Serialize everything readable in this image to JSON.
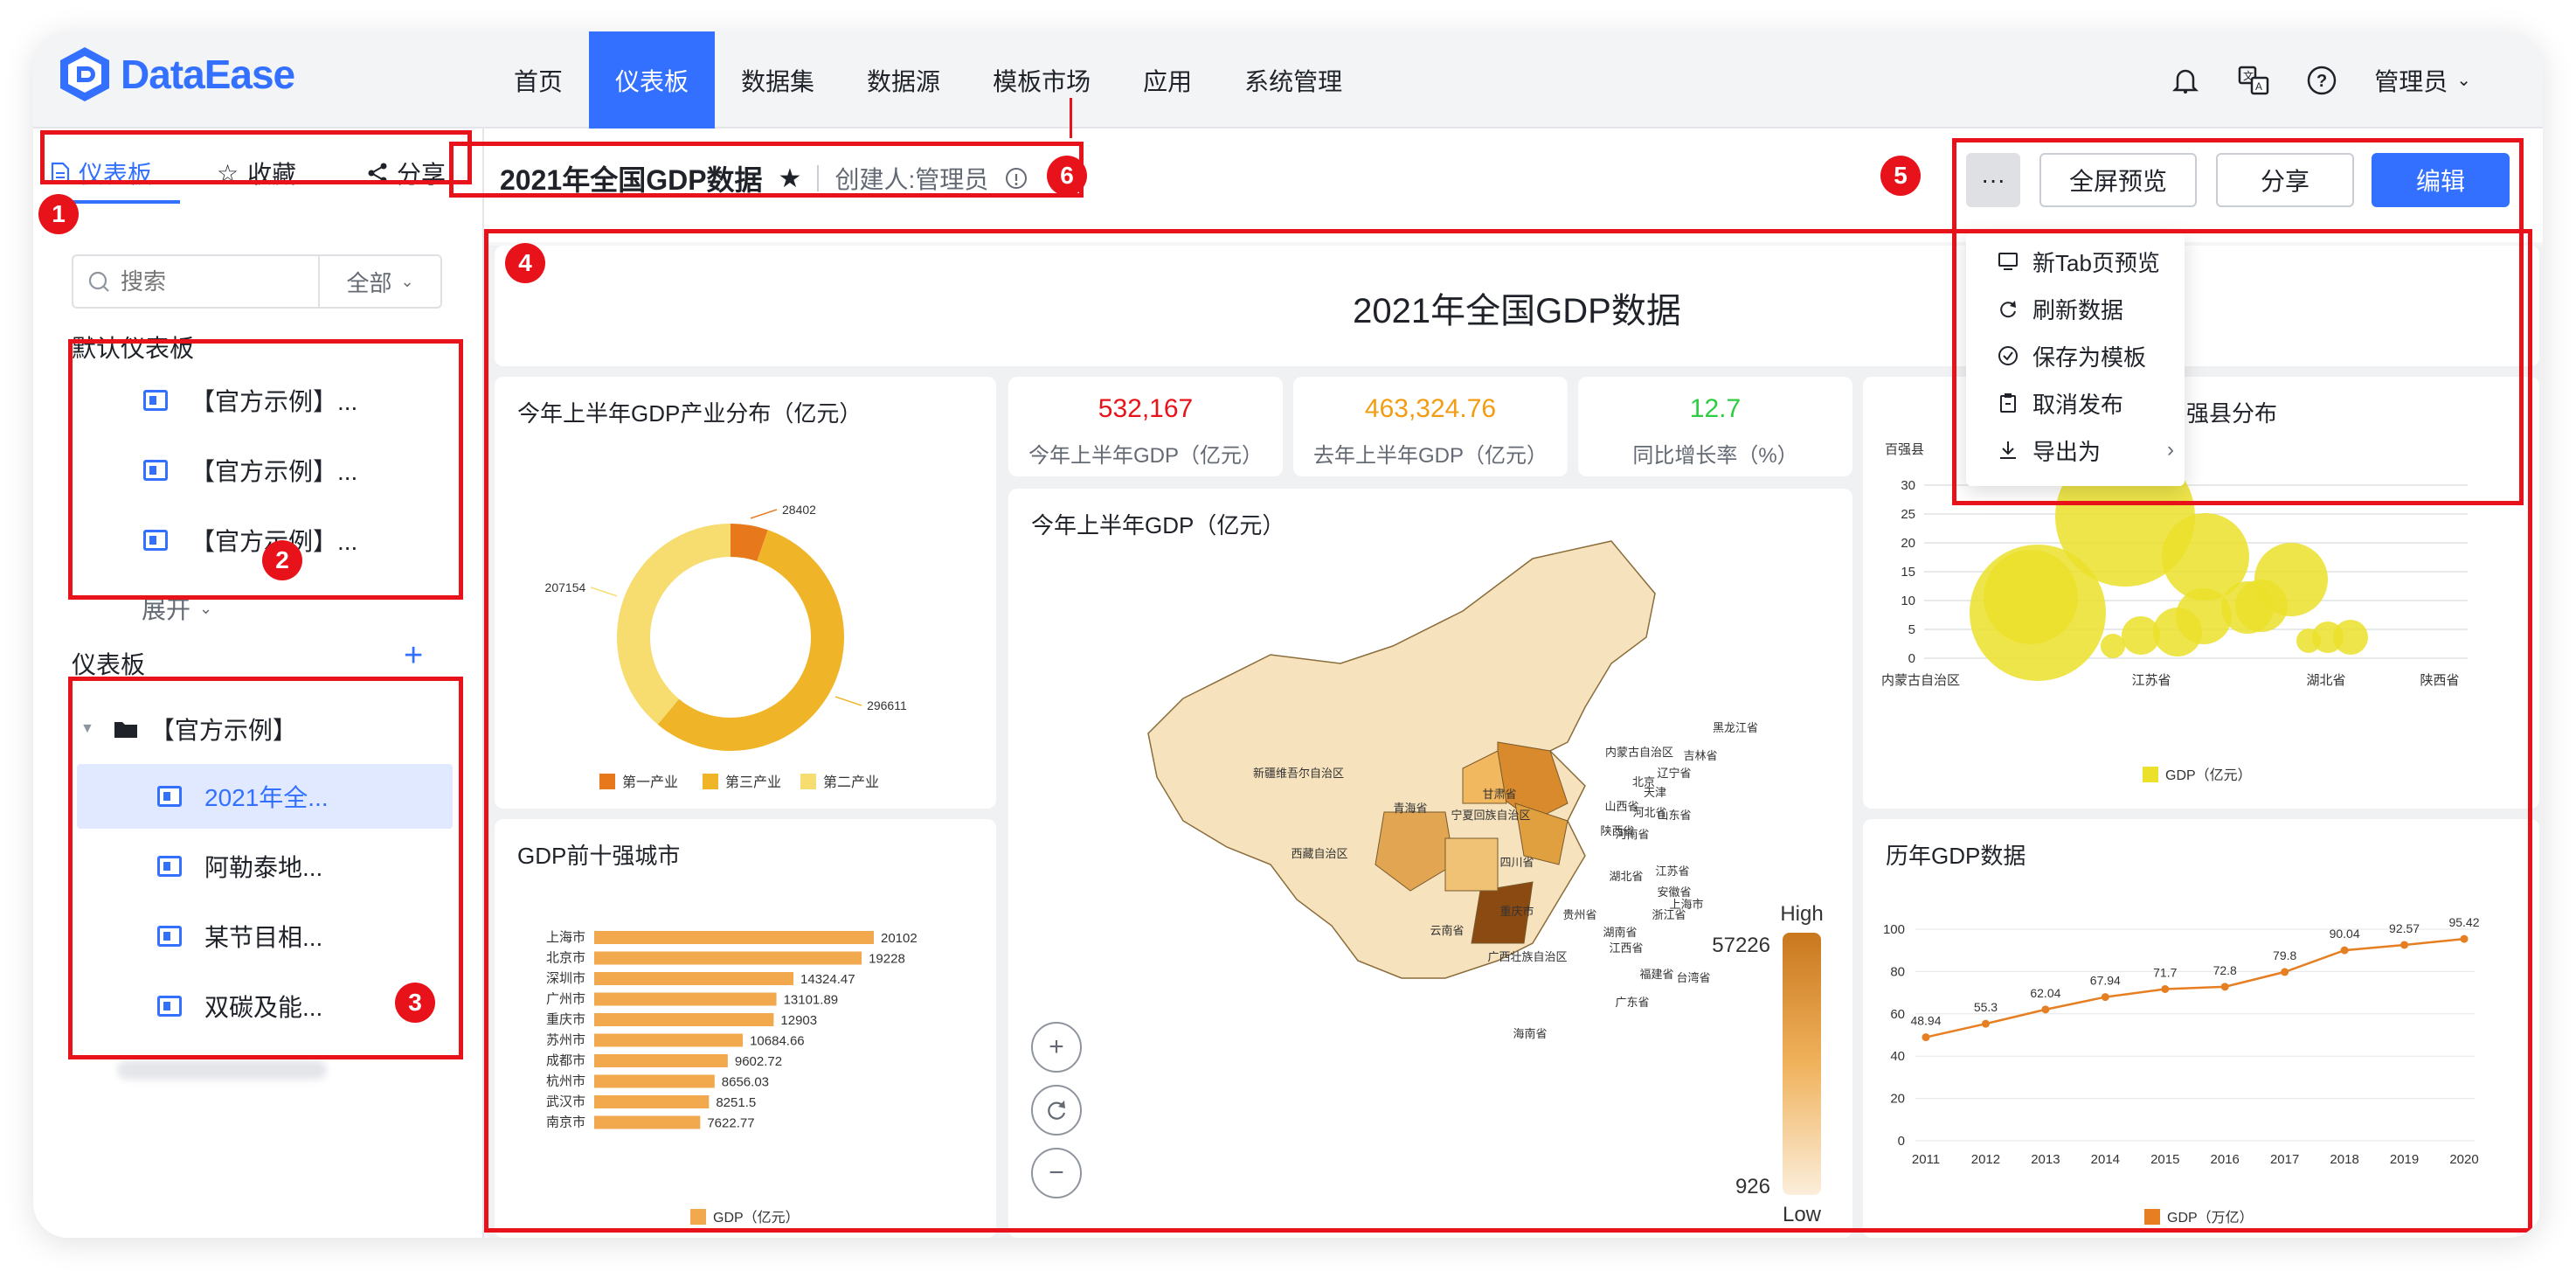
{
  "brand": {
    "name": "DataEase"
  },
  "nav": {
    "items": [
      "首页",
      "仪表板",
      "数据集",
      "数据源",
      "模板市场",
      "应用",
      "系统管理"
    ],
    "active": "仪表板",
    "user": "管理员"
  },
  "sidebar": {
    "tabs": [
      "仪表板",
      "收藏",
      "分享"
    ],
    "search_placeholder": "搜索",
    "filter": "全部",
    "default_title": "默认仪表板",
    "default_items": [
      "【官方示例】...",
      "【官方示例】...",
      "【官方示例】..."
    ],
    "expand_label": "展开",
    "section_title": "仪表板",
    "add_label": "+",
    "folder": "【官方示例】",
    "items": [
      "2021年全...",
      "阿勒泰地...",
      "某节目相...",
      "双碳及能..."
    ]
  },
  "header": {
    "title": "2021年全国GDP数据",
    "creator": "创建人:管理员",
    "more": "···",
    "fullscreen": "全屏预览",
    "share": "分享",
    "edit": "编辑"
  },
  "dropdown": {
    "items": [
      "新Tab页预览",
      "刷新数据",
      "保存为模板",
      "取消发布",
      "导出为"
    ]
  },
  "annotations": [
    "1",
    "2",
    "3",
    "4",
    "5",
    "6"
  ],
  "canvas": {
    "title": "2021年全国GDP数据"
  },
  "kpis": [
    {
      "value": "532,167",
      "label": "今年上半年GDP（亿元）",
      "color": "#e8131a"
    },
    {
      "value": "463,324.76",
      "label": "去年上半年GDP（亿元）",
      "color": "#f39c12"
    },
    {
      "value": "12.7",
      "label": "同比增长率（%）",
      "color": "#2ecc40"
    }
  ],
  "colors": {
    "accent": "#3370ff",
    "annotation": "#e8131a",
    "bar": "#f2a94e",
    "line": "#e67e22"
  },
  "chart_data": [
    {
      "type": "pie",
      "title": "今年上半年GDP产业分布（亿元）",
      "labels": [
        "第一产业",
        "第三产业",
        "第二产业"
      ],
      "values": [
        28402,
        296611,
        207154
      ],
      "colors": [
        "#e8781c",
        "#f0b429",
        "#f7dc6f"
      ]
    },
    {
      "type": "bar",
      "title": "GDP前十强城市",
      "categories": [
        "上海市",
        "北京市",
        "深圳市",
        "广州市",
        "重庆市",
        "苏州市",
        "成都市",
        "杭州市",
        "武汉市",
        "南京市"
      ],
      "values": [
        20102,
        19228,
        14324.47,
        13101.89,
        12903,
        10684.66,
        9602.72,
        8656.03,
        8251.5,
        7622.77
      ],
      "legend": "GDP（亿元）"
    },
    {
      "type": "line",
      "title": "历年GDP数据",
      "x": [
        "2011",
        "2012",
        "2013",
        "2014",
        "2015",
        "2016",
        "2017",
        "2018",
        "2019",
        "2020"
      ],
      "values": [
        48.94,
        55.3,
        62.04,
        67.94,
        71.7,
        72.8,
        79.8,
        90.04,
        92.57,
        95.42
      ],
      "ylim": [
        0,
        100
      ],
      "yticks": [
        "0",
        "20",
        "40",
        "60",
        "80",
        "100"
      ],
      "legend": "GDP（万亿）"
    },
    {
      "type": "scatter",
      "title_visible": "强县分布",
      "ylabel": "百强县",
      "yticks": [
        "0",
        "5",
        "10",
        "15",
        "20",
        "25",
        "30"
      ],
      "xticks": [
        "内蒙古自治区",
        "江苏省",
        "湖北省",
        "陕西省"
      ],
      "legend": "GDP（亿元）"
    },
    {
      "type": "heatmap",
      "title": "今年上半年GDP（亿元）",
      "range_labels": [
        "High",
        "Low"
      ],
      "range_values": [
        "57226",
        "926"
      ],
      "province_labels": [
        "黑龙江省",
        "吉林省",
        "内蒙古自治区",
        "新疆维吾尔自治区",
        "辽宁省",
        "甘肃省",
        "北京",
        "天津",
        "河北省",
        "宁夏回族自治区",
        "山西省",
        "青海省",
        "陕西省",
        "河南省",
        "山东省",
        "西藏自治区",
        "四川省",
        "湖北省",
        "江苏省",
        "安徽省",
        "上海市",
        "重庆市",
        "浙江省",
        "贵州省",
        "湖南省",
        "江西省",
        "云南省",
        "广西壮族自治区",
        "福建省",
        "台湾省",
        "广东省",
        "海南省"
      ]
    }
  ]
}
